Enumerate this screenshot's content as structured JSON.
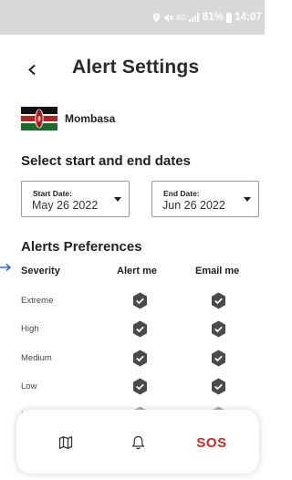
{
  "status_bar": {
    "network": "4G",
    "battery": "81%",
    "time": "14:07"
  },
  "header": {
    "title": "Alert Settings",
    "back_icon": "chevron-left-icon"
  },
  "location": {
    "name": "Mombasa",
    "flag": "kenya-flag"
  },
  "dates": {
    "section_title": "Select start and end dates",
    "start_label": "Start Date:",
    "start_value": "May 26 2022",
    "end_label": "End Date:",
    "end_value": "Jun 26 2022"
  },
  "preferences": {
    "section_title": "Alerts Preferences",
    "columns": [
      "Severity",
      "Alert me",
      "Email me"
    ],
    "rows": [
      {
        "severity": "Extreme",
        "alert_me": true,
        "email_me": true
      },
      {
        "severity": "High",
        "alert_me": true,
        "email_me": true
      },
      {
        "severity": "Medium",
        "alert_me": true,
        "email_me": true
      },
      {
        "severity": "Low",
        "alert_me": true,
        "email_me": true
      },
      {
        "severity": "Mi",
        "alert_me": true,
        "email_me": true
      }
    ]
  },
  "bottom_nav": {
    "map_icon": "map-icon",
    "bell_icon": "bell-icon",
    "sos_label": "SOS"
  },
  "colors": {
    "sos_red": "#d6281f",
    "check_fill": "#4a4a4a",
    "status_bar_bg": "#d8d8d8"
  }
}
